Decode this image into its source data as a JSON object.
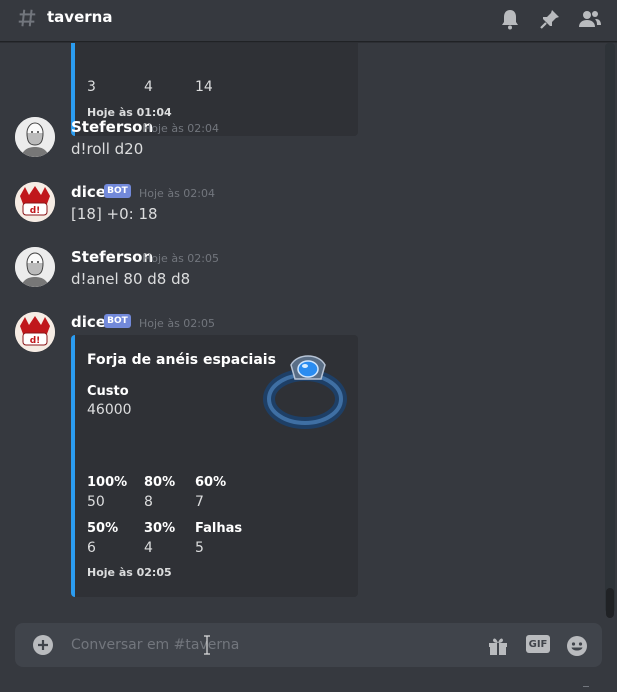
{
  "header": {
    "channel": "taverna"
  },
  "messages_top_embed": {
    "values": [
      "3",
      "4",
      "14"
    ],
    "footer": "Hoje às 01:04"
  },
  "messages": [
    {
      "author": "Steferson",
      "timestamp": "Hoje às 02:04",
      "content": "d!roll d20"
    },
    {
      "author": "dice",
      "badge": "BOT",
      "timestamp": "Hoje às 02:04",
      "content": "[18] +0: 18"
    },
    {
      "author": "Steferson",
      "timestamp": "Hoje às 02:05",
      "content": "d!anel 80 d8 d8"
    },
    {
      "author": "dice",
      "badge": "BOT",
      "timestamp": "Hoje às 02:05"
    }
  ],
  "embed": {
    "title": "Forja de anéis espaciais",
    "fields": [
      {
        "name": "Custo",
        "value": "46000"
      },
      {
        "name": "100%",
        "value": "50"
      },
      {
        "name": "80%",
        "value": "8"
      },
      {
        "name": "60%",
        "value": "7"
      },
      {
        "name": "50%",
        "value": "6"
      },
      {
        "name": "30%",
        "value": "4"
      },
      {
        "name": "Falhas",
        "value": "5"
      }
    ],
    "footer": "Hoje às 02:05",
    "accent_color": "#2b9cf0"
  },
  "input": {
    "placeholder": "Conversar em #taverna",
    "value": ""
  },
  "colors": {
    "background": "#36393f",
    "embed": "#2f3136",
    "bot_badge": "#7289da"
  }
}
